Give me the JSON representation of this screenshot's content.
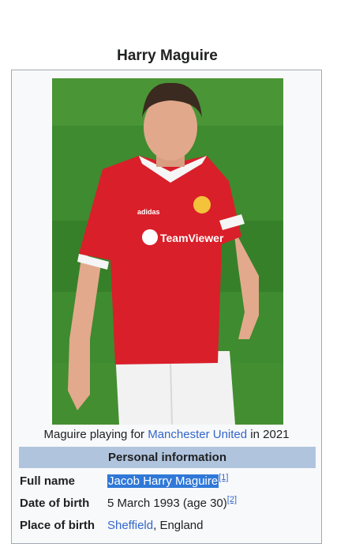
{
  "title": "Harry Maguire",
  "image": {
    "subject": "Harry Maguire",
    "sponsor_text": "TeamViewer",
    "kit_brand": "adidas"
  },
  "caption": {
    "prefix": "Maguire playing for ",
    "link": "Manchester United",
    "suffix": " in 2021"
  },
  "section_header": "Personal information",
  "rows": [
    {
      "label": "Full name",
      "value": "Jacob Harry Maguire",
      "ref": "[1]"
    },
    {
      "label": "Date of birth",
      "value": "5 March 1993 (age 30)",
      "ref": "[2]"
    },
    {
      "label": "Place of birth",
      "value_link": "Sheffield",
      "value_rest": ", England"
    }
  ],
  "colors": {
    "link": "#3366cc",
    "header_bg": "#b0c4de",
    "selection": "#2f78d8",
    "infobox_bg": "#f8f9fa",
    "border": "#a2a9b1",
    "pitch": "#3e8a2e",
    "kit_red": "#d91f2a"
  }
}
